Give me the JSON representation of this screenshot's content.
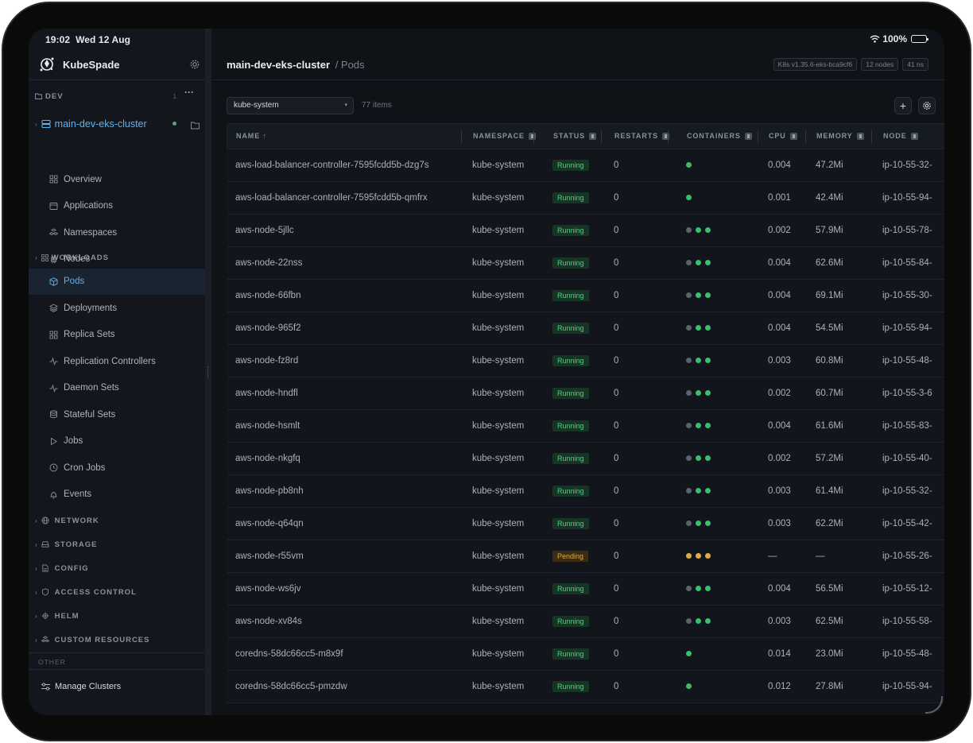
{
  "status_bar": {
    "time": "19:02",
    "date": "Wed 12 Aug",
    "battery": "100%",
    "battery_level": 1.0
  },
  "app": {
    "name": "KubeSpade"
  },
  "sidebar": {
    "group_label": "DEV",
    "group_count": "1",
    "group_more": "···",
    "cluster_name": "main-dev-eks-cluster",
    "items": [
      {
        "label": "Overview",
        "icon": "grid-icon"
      },
      {
        "label": "Applications",
        "icon": "window-icon"
      },
      {
        "label": "Namespaces",
        "icon": "cubes-icon"
      },
      {
        "label": "Nodes",
        "icon": "chip-icon"
      }
    ],
    "workloads_label": "WORKLOADS",
    "workloads": [
      {
        "label": "Pods",
        "icon": "cube-icon",
        "active": true
      },
      {
        "label": "Deployments",
        "icon": "layers-icon"
      },
      {
        "label": "Replica Sets",
        "icon": "grid-icon"
      },
      {
        "label": "Replication Controllers",
        "icon": "pulse-icon"
      },
      {
        "label": "Daemon Sets",
        "icon": "pulse-icon"
      },
      {
        "label": "Stateful Sets",
        "icon": "database-icon"
      },
      {
        "label": "Jobs",
        "icon": "play-icon"
      },
      {
        "label": "Cron Jobs",
        "icon": "clock-icon"
      },
      {
        "label": "Events",
        "icon": "bell-icon"
      }
    ],
    "groups": [
      {
        "label": "NETWORK",
        "icon": "globe-icon"
      },
      {
        "label": "STORAGE",
        "icon": "drive-icon"
      },
      {
        "label": "CONFIG",
        "icon": "file-icon"
      },
      {
        "label": "ACCESS CONTROL",
        "icon": "shield-icon"
      },
      {
        "label": "HELM",
        "icon": "helm-icon"
      },
      {
        "label": "CUSTOM RESOURCES",
        "icon": "cubes-icon"
      }
    ],
    "other_label": "OTHER",
    "manage_clusters": "Manage Clusters"
  },
  "header": {
    "cluster": "main-dev-eks-cluster",
    "crumb": "/ Pods",
    "badges": [
      "K8s v1.35.6-eks-bca9cf6",
      "12 nodes",
      "41 ns"
    ]
  },
  "toolbar": {
    "namespace": "kube-system",
    "items_count": "77 items",
    "add_label": "+"
  },
  "table": {
    "columns": [
      "NAME ↑",
      "NAMESPACE",
      "STATUS",
      "RESTARTS",
      "CONTAINERS",
      "CPU",
      "MEMORY",
      "NODE"
    ],
    "rows": [
      {
        "name": "aws-load-balancer-controller-7595fcdd5b-dzg7s",
        "namespace": "kube-system",
        "status": "Running",
        "restarts": "0",
        "containers": [
          "green"
        ],
        "cpu": "0.004",
        "memory": "47.2Mi",
        "node": "ip-10-55-32-"
      },
      {
        "name": "aws-load-balancer-controller-7595fcdd5b-qmfrx",
        "namespace": "kube-system",
        "status": "Running",
        "restarts": "0",
        "containers": [
          "green"
        ],
        "cpu": "0.001",
        "memory": "42.4Mi",
        "node": "ip-10-55-94-"
      },
      {
        "name": "aws-node-5jllc",
        "namespace": "kube-system",
        "status": "Running",
        "restarts": "0",
        "containers": [
          "grey",
          "green",
          "green"
        ],
        "cpu": "0.002",
        "memory": "57.9Mi",
        "node": "ip-10-55-78-"
      },
      {
        "name": "aws-node-22nss",
        "namespace": "kube-system",
        "status": "Running",
        "restarts": "0",
        "containers": [
          "grey",
          "green",
          "green"
        ],
        "cpu": "0.004",
        "memory": "62.6Mi",
        "node": "ip-10-55-84-"
      },
      {
        "name": "aws-node-66fbn",
        "namespace": "kube-system",
        "status": "Running",
        "restarts": "0",
        "containers": [
          "grey",
          "green",
          "green"
        ],
        "cpu": "0.004",
        "memory": "69.1Mi",
        "node": "ip-10-55-30-"
      },
      {
        "name": "aws-node-965f2",
        "namespace": "kube-system",
        "status": "Running",
        "restarts": "0",
        "containers": [
          "grey",
          "green",
          "green"
        ],
        "cpu": "0.004",
        "memory": "54.5Mi",
        "node": "ip-10-55-94-"
      },
      {
        "name": "aws-node-fz8rd",
        "namespace": "kube-system",
        "status": "Running",
        "restarts": "0",
        "containers": [
          "grey",
          "green",
          "green"
        ],
        "cpu": "0.003",
        "memory": "60.8Mi",
        "node": "ip-10-55-48-"
      },
      {
        "name": "aws-node-hndfl",
        "namespace": "kube-system",
        "status": "Running",
        "restarts": "0",
        "containers": [
          "grey",
          "green",
          "green"
        ],
        "cpu": "0.002",
        "memory": "60.7Mi",
        "node": "ip-10-55-3-6"
      },
      {
        "name": "aws-node-hsmlt",
        "namespace": "kube-system",
        "status": "Running",
        "restarts": "0",
        "containers": [
          "grey",
          "green",
          "green"
        ],
        "cpu": "0.004",
        "memory": "61.6Mi",
        "node": "ip-10-55-83-"
      },
      {
        "name": "aws-node-nkgfq",
        "namespace": "kube-system",
        "status": "Running",
        "restarts": "0",
        "containers": [
          "grey",
          "green",
          "green"
        ],
        "cpu": "0.002",
        "memory": "57.2Mi",
        "node": "ip-10-55-40-"
      },
      {
        "name": "aws-node-pb8nh",
        "namespace": "kube-system",
        "status": "Running",
        "restarts": "0",
        "containers": [
          "grey",
          "green",
          "green"
        ],
        "cpu": "0.003",
        "memory": "61.4Mi",
        "node": "ip-10-55-32-"
      },
      {
        "name": "aws-node-q64qn",
        "namespace": "kube-system",
        "status": "Running",
        "restarts": "0",
        "containers": [
          "grey",
          "green",
          "green"
        ],
        "cpu": "0.003",
        "memory": "62.2Mi",
        "node": "ip-10-55-42-"
      },
      {
        "name": "aws-node-r55vm",
        "namespace": "kube-system",
        "status": "Pending",
        "restarts": "0",
        "containers": [
          "amber",
          "amber",
          "amber"
        ],
        "cpu": "—",
        "memory": "—",
        "node": "ip-10-55-26-"
      },
      {
        "name": "aws-node-ws6jv",
        "namespace": "kube-system",
        "status": "Running",
        "restarts": "0",
        "containers": [
          "grey",
          "green",
          "green"
        ],
        "cpu": "0.004",
        "memory": "56.5Mi",
        "node": "ip-10-55-12-"
      },
      {
        "name": "aws-node-xv84s",
        "namespace": "kube-system",
        "status": "Running",
        "restarts": "0",
        "containers": [
          "grey",
          "green",
          "green"
        ],
        "cpu": "0.003",
        "memory": "62.5Mi",
        "node": "ip-10-55-58-"
      },
      {
        "name": "coredns-58dc66cc5-m8x9f",
        "namespace": "kube-system",
        "status": "Running",
        "restarts": "0",
        "containers": [
          "green"
        ],
        "cpu": "0.014",
        "memory": "23.0Mi",
        "node": "ip-10-55-48-"
      },
      {
        "name": "coredns-58dc66cc5-pmzdw",
        "namespace": "kube-system",
        "status": "Running",
        "restarts": "0",
        "containers": [
          "green"
        ],
        "cpu": "0.012",
        "memory": "27.8Mi",
        "node": "ip-10-55-94-"
      }
    ]
  },
  "colors": {
    "accent": "#5fb3f0",
    "running": "#5cc98a",
    "pending": "#e1a84a",
    "background": "#0f1217",
    "sidebar": "#13171d"
  }
}
